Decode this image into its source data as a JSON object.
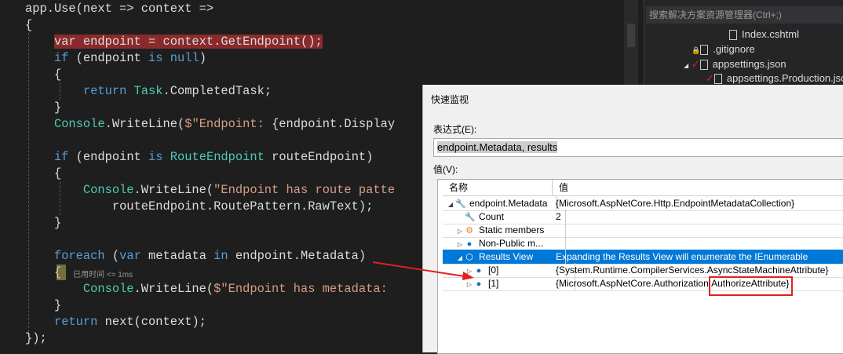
{
  "code": {
    "lines": [
      [
        [
          "pl",
          "app.Use(next => context =>"
        ]
      ],
      [
        [
          "pl",
          "{"
        ]
      ],
      [
        [
          "pl",
          "    "
        ],
        [
          "bp",
          "var endpoint = context.GetEndpoint();"
        ]
      ],
      [
        [
          "pl",
          "    "
        ],
        [
          "kw",
          "if"
        ],
        [
          "pl",
          " (endpoint "
        ],
        [
          "kw",
          "is"
        ],
        [
          "pl",
          " "
        ],
        [
          "kw",
          "null"
        ],
        [
          "pl",
          ")"
        ]
      ],
      [
        [
          "pl",
          "    {"
        ]
      ],
      [
        [
          "pl",
          "        "
        ],
        [
          "kw",
          "return"
        ],
        [
          "pl",
          " "
        ],
        [
          "ty",
          "Task"
        ],
        [
          "pl",
          ".CompletedTask;"
        ]
      ],
      [
        [
          "pl",
          "    }"
        ]
      ],
      [
        [
          "pl",
          "    "
        ],
        [
          "ty",
          "Console"
        ],
        [
          "pl",
          ".WriteLine("
        ],
        [
          "st",
          "$\"Endpoint: "
        ],
        [
          "pl",
          "{endpoint.Display"
        ]
      ],
      [],
      [
        [
          "pl",
          "    "
        ],
        [
          "kw",
          "if"
        ],
        [
          "pl",
          " (endpoint "
        ],
        [
          "kw",
          "is"
        ],
        [
          "pl",
          " "
        ],
        [
          "ty",
          "RouteEndpoint"
        ],
        [
          "pl",
          " routeEndpoint)"
        ]
      ],
      [
        [
          "pl",
          "    {"
        ]
      ],
      [
        [
          "pl",
          "        "
        ],
        [
          "ty",
          "Console"
        ],
        [
          "pl",
          ".WriteLine("
        ],
        [
          "st",
          "\"Endpoint has route patte"
        ]
      ],
      [
        [
          "pl",
          "            routeEndpoint.RoutePattern.RawText);"
        ]
      ],
      [
        [
          "pl",
          "    }"
        ]
      ],
      [],
      [
        [
          "pl",
          "    "
        ],
        [
          "kw",
          "foreach"
        ],
        [
          "pl",
          " ("
        ],
        [
          "kw",
          "var"
        ],
        [
          "pl",
          " metadata "
        ],
        [
          "kw",
          "in"
        ],
        [
          "pl",
          " endpoint.Metadata)"
        ]
      ],
      [
        [
          "pl",
          "    {"
        ]
      ],
      [
        [
          "pl",
          "        "
        ],
        [
          "ty",
          "Console"
        ],
        [
          "pl",
          ".WriteLine("
        ],
        [
          "st",
          "$\"Endpoint has metadata: "
        ]
      ],
      [
        [
          "pl",
          "    }"
        ]
      ],
      [
        [
          "pl",
          "    "
        ],
        [
          "kw",
          "return"
        ],
        [
          "pl",
          " next(context);"
        ]
      ],
      [
        [
          "pl",
          "});"
        ]
      ]
    ],
    "perf_hint": "已用时间 <= 1ms"
  },
  "solution_explorer": {
    "search_placeholder": "搜索解决方案资源管理器(Ctrl+;)",
    "items": [
      "Index.cshtml",
      ".gitignore",
      "appsettings.json",
      "appsettings.Production.json"
    ]
  },
  "quickwatch": {
    "title": "快速监视",
    "expression_label": "表达式(E):",
    "expression": "endpoint.Metadata, results",
    "value_label": "值(V):",
    "columns": [
      "名称",
      "值"
    ],
    "rows": [
      {
        "name": "endpoint.Metadata",
        "value": "{Microsoft.AspNetCore.Http.EndpointMetadataCollection}",
        "expander": "expanded",
        "icon": "wrench-icon",
        "indent": 0
      },
      {
        "name": "Count",
        "value": "2",
        "expander": "none",
        "icon": "wrench-icon",
        "indent": 1
      },
      {
        "name": "Static members",
        "value": "",
        "expander": "collapsed",
        "icon": "static-members-icon",
        "indent": 1
      },
      {
        "name": "Non-Public m...",
        "value": "",
        "expander": "collapsed",
        "icon": "field-icon",
        "indent": 1
      },
      {
        "name": "Results View",
        "value": "Expanding the Results View will enumerate the IEnumerable",
        "expander": "expanded",
        "icon": "results-view-icon",
        "indent": 1,
        "selected": true
      },
      {
        "name": "[0]",
        "value": "{System.Runtime.CompilerServices.AsyncStateMachineAttribute}",
        "expander": "collapsed",
        "icon": "field-icon",
        "indent": 2
      },
      {
        "name": "[1]",
        "value": "{Microsoft.AspNetCore.Authorization.AuthorizeAttribute}",
        "expander": "collapsed",
        "icon": "field-icon",
        "indent": 2
      }
    ]
  },
  "colors": {
    "annotation": "#e02020",
    "selection": "#0078d7",
    "breakpoint": "#8a2a2a"
  }
}
